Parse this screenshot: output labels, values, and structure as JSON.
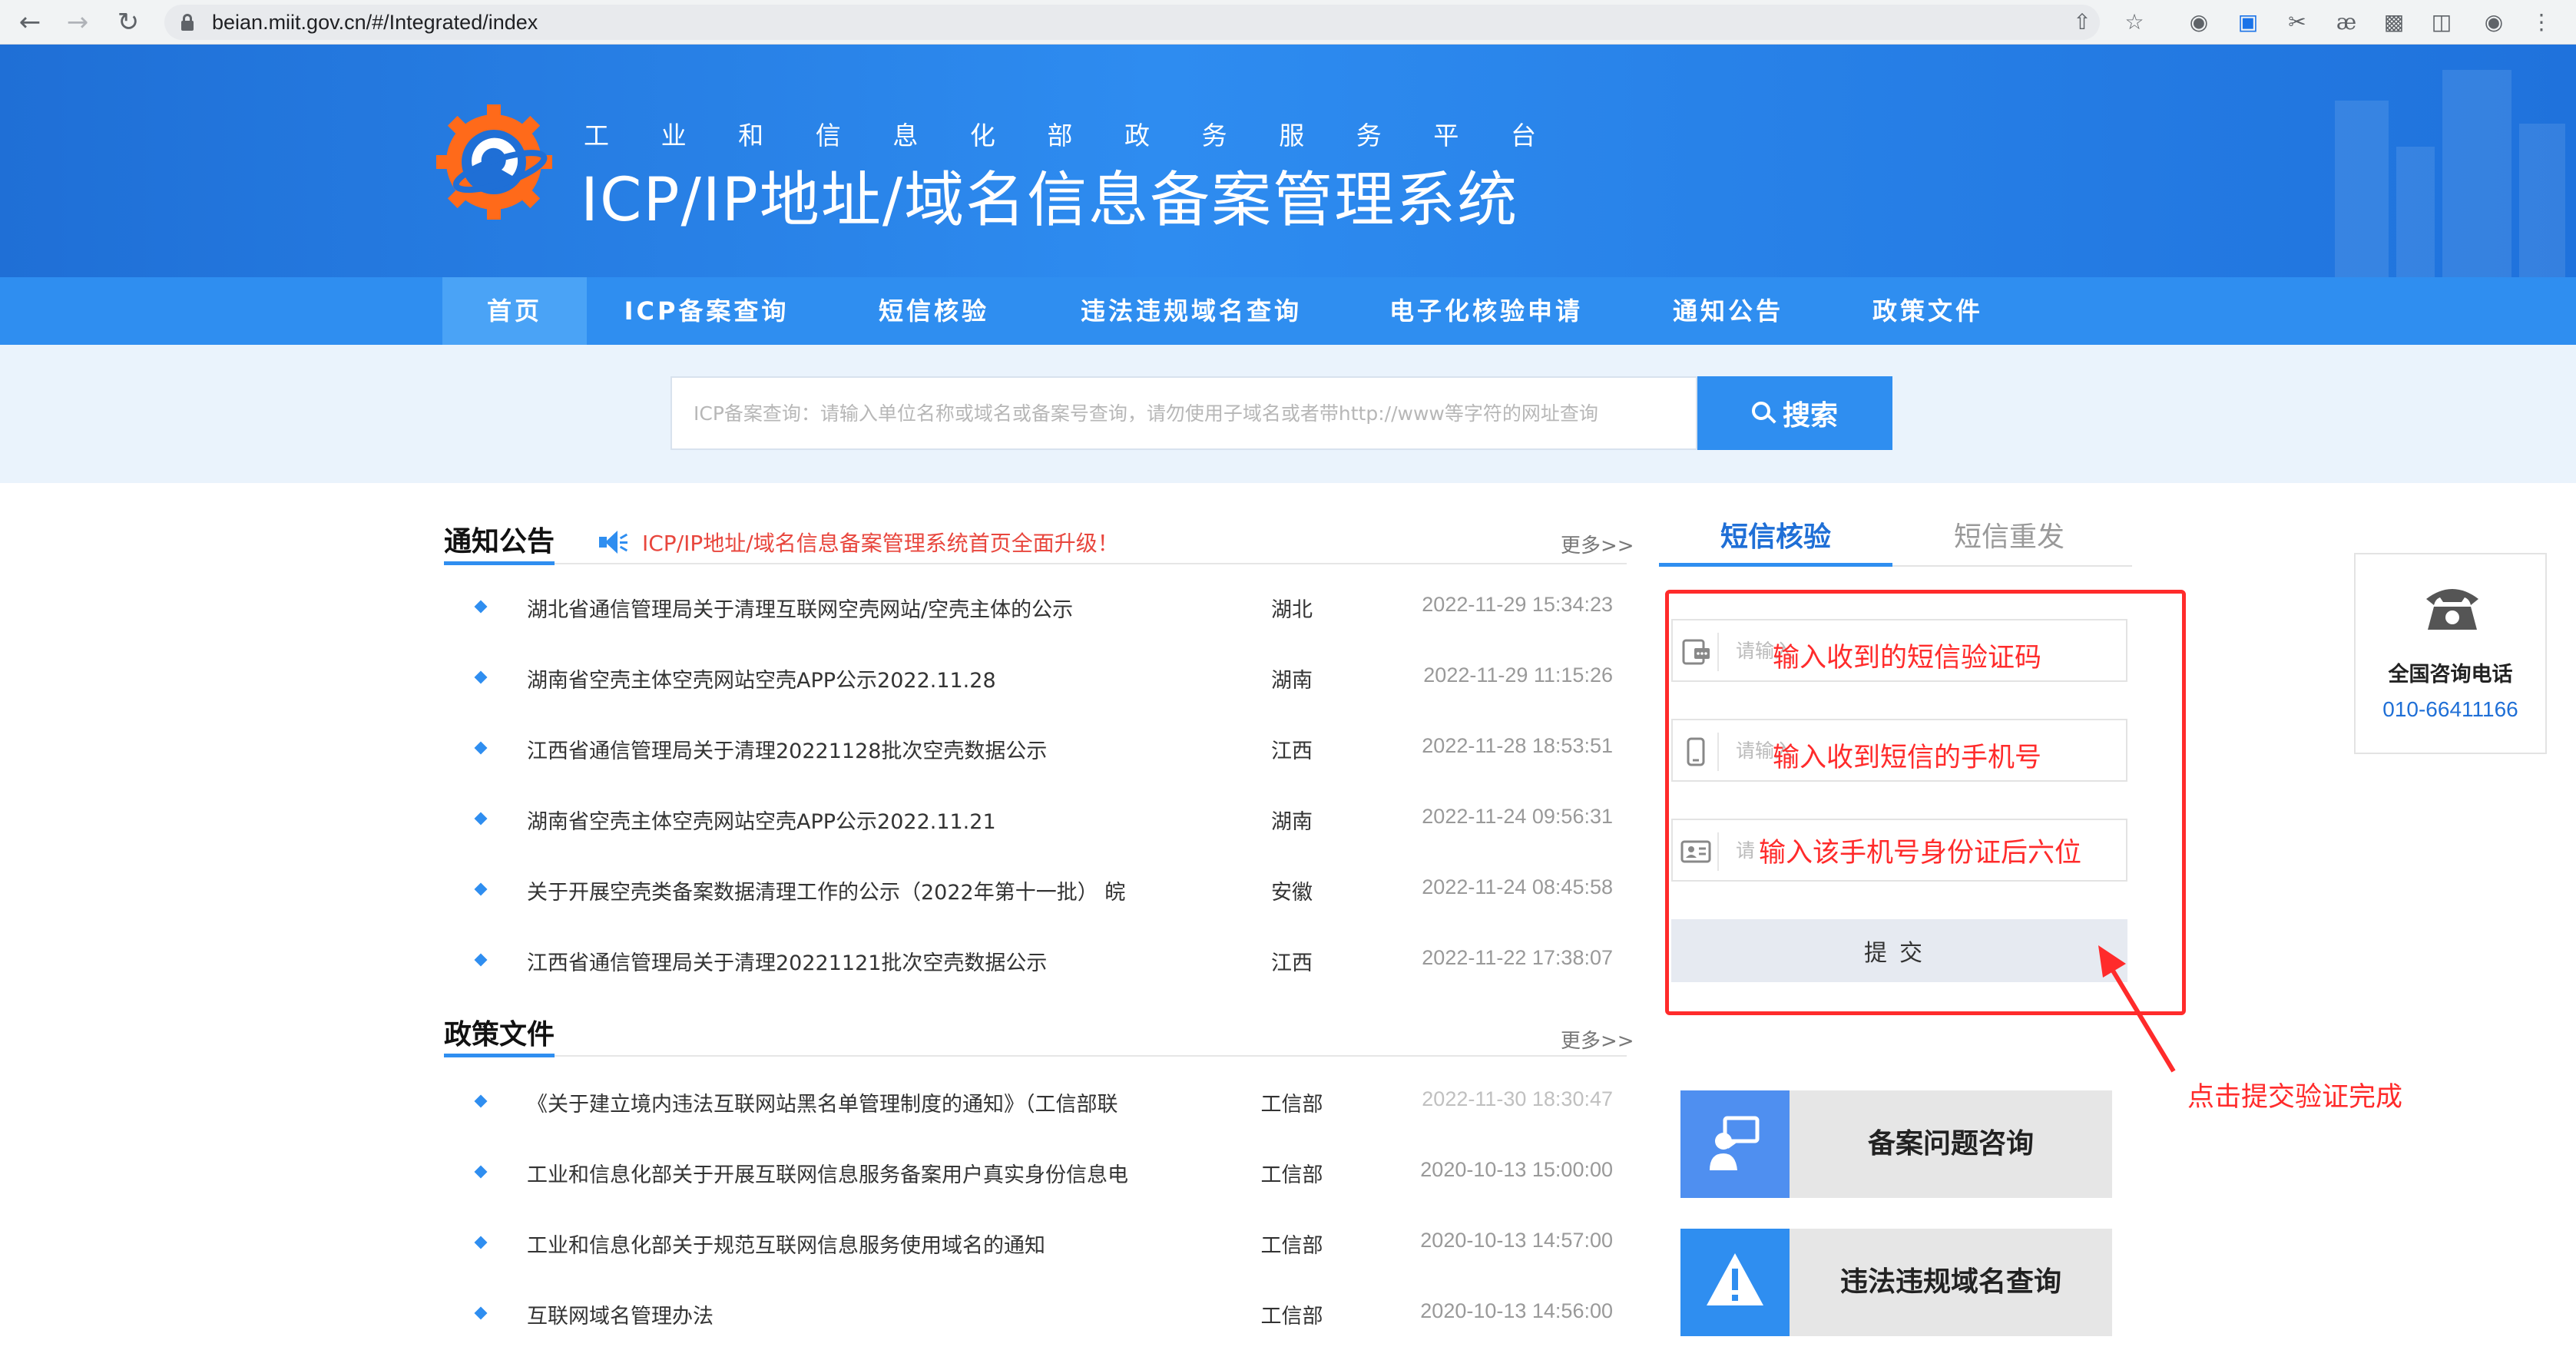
{
  "browser": {
    "url": "beian.miit.gov.cn/#/Integrated/index",
    "icons": [
      "back-icon",
      "forward-icon",
      "reload-icon",
      "lock-icon",
      "share-icon",
      "bookmark-star-icon",
      "extension-icon",
      "puzzle-icon",
      "sidebar-icon",
      "profile-icon",
      "menu-icon"
    ]
  },
  "header": {
    "subtitle_chars": [
      "工",
      "业",
      "和",
      "信",
      "息",
      "化",
      "部",
      "政",
      "务",
      "服",
      "务",
      "平",
      "台"
    ],
    "title": "ICP/IP地址/域名信息备案管理系统"
  },
  "nav": {
    "items": [
      "首页",
      "ICP备案查询",
      "短信核验",
      "违法违规域名查询",
      "电子化核验申请",
      "通知公告",
      "政策文件"
    ],
    "active_index": 0
  },
  "search": {
    "placeholder": "ICP备案查询：请输入单位名称或域名或备案号查询，请勿使用子域名或者带http://www等字符的网址查询",
    "button_label": "搜索"
  },
  "notices": {
    "title": "通知公告",
    "flash": "ICP/IP地址/域名信息备案管理系统首页全面升级！",
    "more": "更多>>",
    "rows": [
      {
        "title": "湖北省通信管理局关于清理互联网空壳网站/空壳主体的公示",
        "region": "湖北",
        "date": "2022-11-29 15:34:23"
      },
      {
        "title": "湖南省空壳主体空壳网站空壳APP公示2022.11.28",
        "region": "湖南",
        "date": "2022-11-29 11:15:26"
      },
      {
        "title": "江西省通信管理局关于清理20221128批次空壳数据公示",
        "region": "江西",
        "date": "2022-11-28 18:53:51"
      },
      {
        "title": "湖南省空壳主体空壳网站空壳APP公示2022.11.21",
        "region": "湖南",
        "date": "2022-11-24 09:56:31"
      },
      {
        "title": "关于开展空壳类备案数据清理工作的公示（2022年第十一批） 皖",
        "region": "安徽",
        "date": "2022-11-24 08:45:58"
      },
      {
        "title": "江西省通信管理局关于清理20221121批次空壳数据公示",
        "region": "江西",
        "date": "2022-11-22 17:38:07"
      }
    ]
  },
  "policies": {
    "title": "政策文件",
    "more": "更多>>",
    "rows": [
      {
        "title": "《关于建立境内违法互联网站黑名单管理制度的通知》（工信部联",
        "region": "工信部",
        "date": "2022-11-30 18:30:47"
      },
      {
        "title": "工业和信息化部关于开展互联网信息服务备案用户真实身份信息电",
        "region": "工信部",
        "date": "2020-10-13 15:00:00"
      },
      {
        "title": "工业和信息化部关于规范互联网信息服务使用域名的通知",
        "region": "工信部",
        "date": "2020-10-13 14:57:00"
      },
      {
        "title": "互联网域名管理办法",
        "region": "工信部",
        "date": "2020-10-13 14:56:00"
      }
    ]
  },
  "sms_panel": {
    "tabs": [
      "短信核验",
      "短信重发"
    ],
    "fields": [
      {
        "placeholder": "请输入",
        "annotation": "输入收到的短信验证码",
        "icon": "sms-code-icon"
      },
      {
        "placeholder": "请输入",
        "annotation": "输入收到短信的手机号",
        "icon": "mobile-phone-icon"
      },
      {
        "placeholder": "请",
        "annotation": "输入该手机号身份证后六位",
        "icon": "id-card-icon"
      }
    ],
    "submit_label": "提交",
    "arrow_label": "点击提交验证完成",
    "annotation_color": "#ff2b2b"
  },
  "cards": [
    {
      "label": "备案问题咨询",
      "icon": "consult-icon"
    },
    {
      "label": "违法违规域名查询",
      "icon": "warning-icon"
    }
  ],
  "hotline": {
    "label": "全国咨询电话",
    "number": "010-66411166",
    "icon": "telephone-icon"
  },
  "colors": {
    "brand_blue": "#2f8ef0",
    "nav_active": "#4aa3f6",
    "date_gray": "#999999",
    "alert_red": "#e8463d"
  }
}
